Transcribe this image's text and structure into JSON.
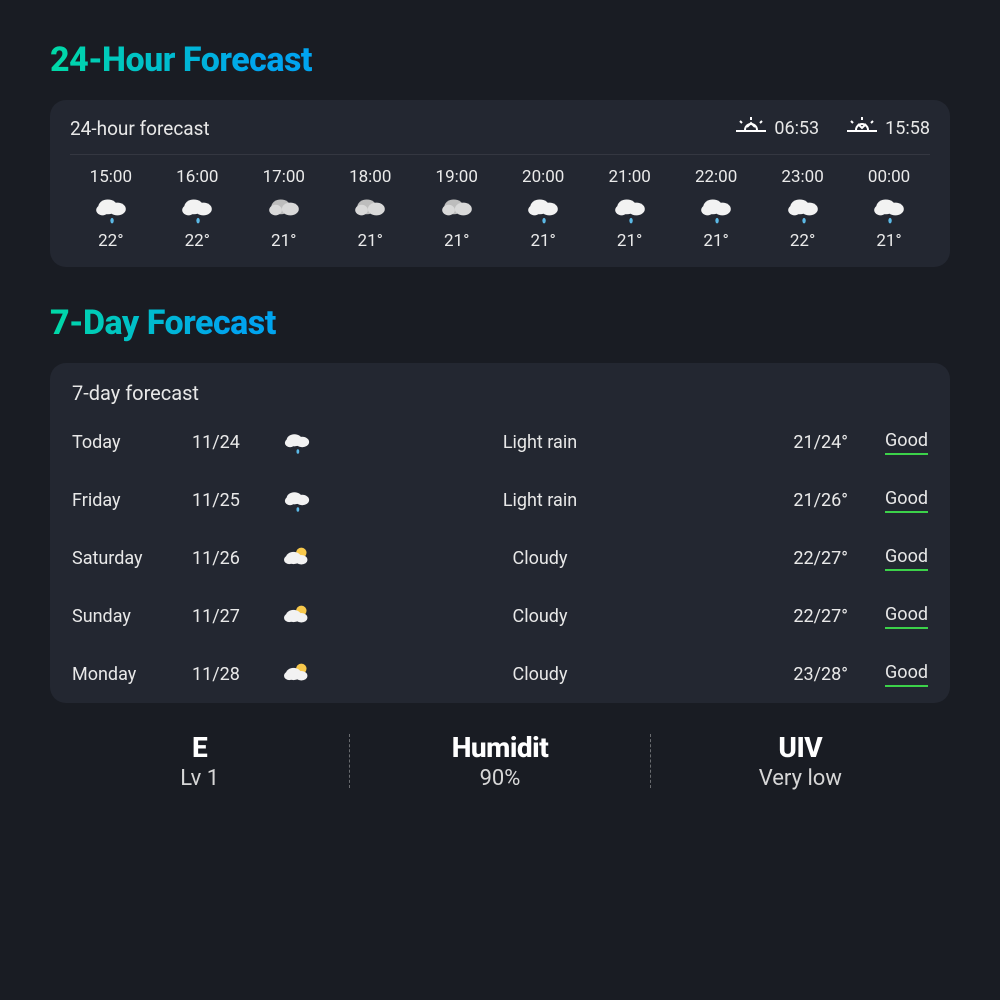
{
  "header_24h_title": "24-Hour Forecast",
  "card_24h_label": "24-hour forecast",
  "sunrise": "06:53",
  "sunset": "15:58",
  "hours": [
    {
      "time": "15:00",
      "icon": "rain",
      "temp": "22°"
    },
    {
      "time": "16:00",
      "icon": "rain",
      "temp": "22°"
    },
    {
      "time": "17:00",
      "icon": "cloud-gray",
      "temp": "21°"
    },
    {
      "time": "18:00",
      "icon": "cloud-gray",
      "temp": "21°"
    },
    {
      "time": "19:00",
      "icon": "cloud-gray",
      "temp": "21°"
    },
    {
      "time": "20:00",
      "icon": "rain",
      "temp": "21°"
    },
    {
      "time": "21:00",
      "icon": "rain",
      "temp": "21°"
    },
    {
      "time": "22:00",
      "icon": "rain",
      "temp": "21°"
    },
    {
      "time": "23:00",
      "icon": "rain",
      "temp": "22°"
    },
    {
      "time": "00:00",
      "icon": "rain",
      "temp": "21°"
    }
  ],
  "header_7d_title": "7-Day Forecast",
  "card_7d_label": "7-day forecast",
  "days": [
    {
      "day": "Today",
      "date": "11/24",
      "icon": "rain",
      "cond": "Light rain",
      "temps": "21/24°",
      "quality": "Good"
    },
    {
      "day": "Friday",
      "date": "11/25",
      "icon": "rain",
      "cond": "Light rain",
      "temps": "21/26°",
      "quality": "Good"
    },
    {
      "day": "Saturday",
      "date": "11/26",
      "icon": "cloud-sun",
      "cond": "Cloudy",
      "temps": "22/27°",
      "quality": "Good"
    },
    {
      "day": "Sunday",
      "date": "11/27",
      "icon": "cloud-sun",
      "cond": "Cloudy",
      "temps": "22/27°",
      "quality": "Good"
    },
    {
      "day": "Monday",
      "date": "11/28",
      "icon": "cloud-sun",
      "cond": "Cloudy",
      "temps": "23/28°",
      "quality": "Good"
    }
  ],
  "metrics": {
    "wind_label": "E",
    "wind_value": "Lv 1",
    "humid_label": "Humidit",
    "humid_value": "90%",
    "uv_label": "UIV",
    "uv_value": "Very low"
  }
}
